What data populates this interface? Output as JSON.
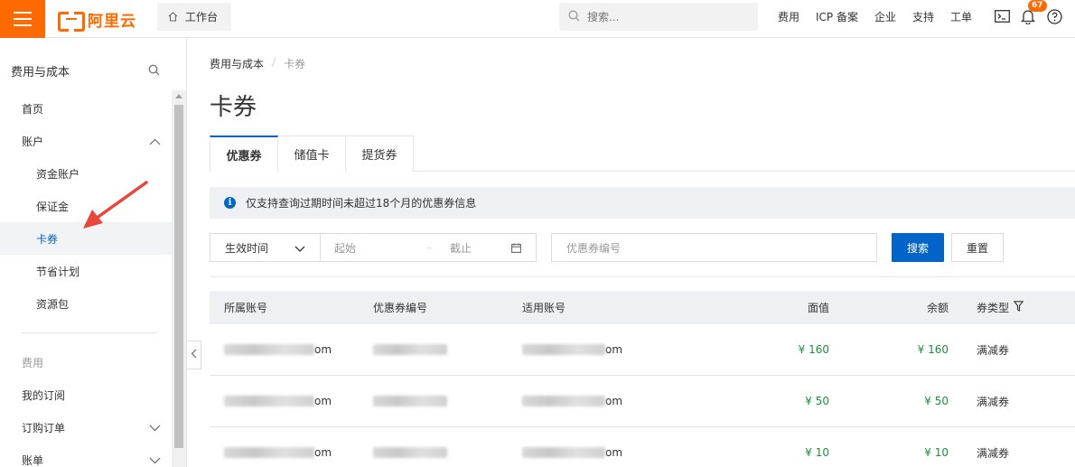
{
  "topbar": {
    "logo_text": "阿里云",
    "workbench_label": "工作台",
    "search_placeholder": "搜索...",
    "links": [
      "费用",
      "ICP 备案",
      "企业",
      "支持",
      "工单"
    ],
    "notification_count": "67",
    "accent_color": "#ff6a00"
  },
  "sidebar": {
    "title": "费用与成本",
    "items": [
      {
        "label": "首页"
      },
      {
        "label": "账户"
      },
      {
        "label": "资金账户"
      },
      {
        "label": "保证金"
      },
      {
        "label": "卡券"
      },
      {
        "label": "节省计划"
      },
      {
        "label": "资源包"
      },
      {
        "label": "费用"
      },
      {
        "label": "我的订阅"
      },
      {
        "label": "订购订单"
      },
      {
        "label": "账单"
      }
    ],
    "active_item": "卡券"
  },
  "main": {
    "breadcrumb": [
      "费用与成本",
      "卡券"
    ],
    "title": "卡券",
    "tabs": [
      {
        "label": "优惠券",
        "active": true
      },
      {
        "label": "储值卡",
        "active": false
      },
      {
        "label": "提货券",
        "active": false
      }
    ],
    "info_text": "仅支持查询过期时间未超过18个月的优惠券信息",
    "filter": {
      "date_type": "生效时间",
      "start_placeholder": "起始",
      "range_sep": "-",
      "end_placeholder": "截止",
      "coupon_placeholder": "优惠券编号",
      "search_label": "搜索",
      "reset_label": "重置"
    },
    "table": {
      "headers": [
        "所属账号",
        "优惠券编号",
        "适用账号",
        "面值",
        "余额",
        "券类型"
      ],
      "rows": [
        {
          "owner_suffix": "om",
          "app_suffix": "om",
          "face": "¥ 160",
          "balance": "¥ 160",
          "type": "满减券"
        },
        {
          "owner_suffix": "om",
          "app_suffix": "om",
          "face": "¥ 50",
          "balance": "¥ 50",
          "type": "满减券"
        },
        {
          "owner_suffix": "om",
          "app_suffix": "om",
          "face": "¥ 10",
          "balance": "¥ 10",
          "type": "满减券"
        }
      ]
    }
  },
  "colors": {
    "primary": "#0064c8",
    "money": "#1e8e3e",
    "annotation_arrow": "#e8453c"
  }
}
